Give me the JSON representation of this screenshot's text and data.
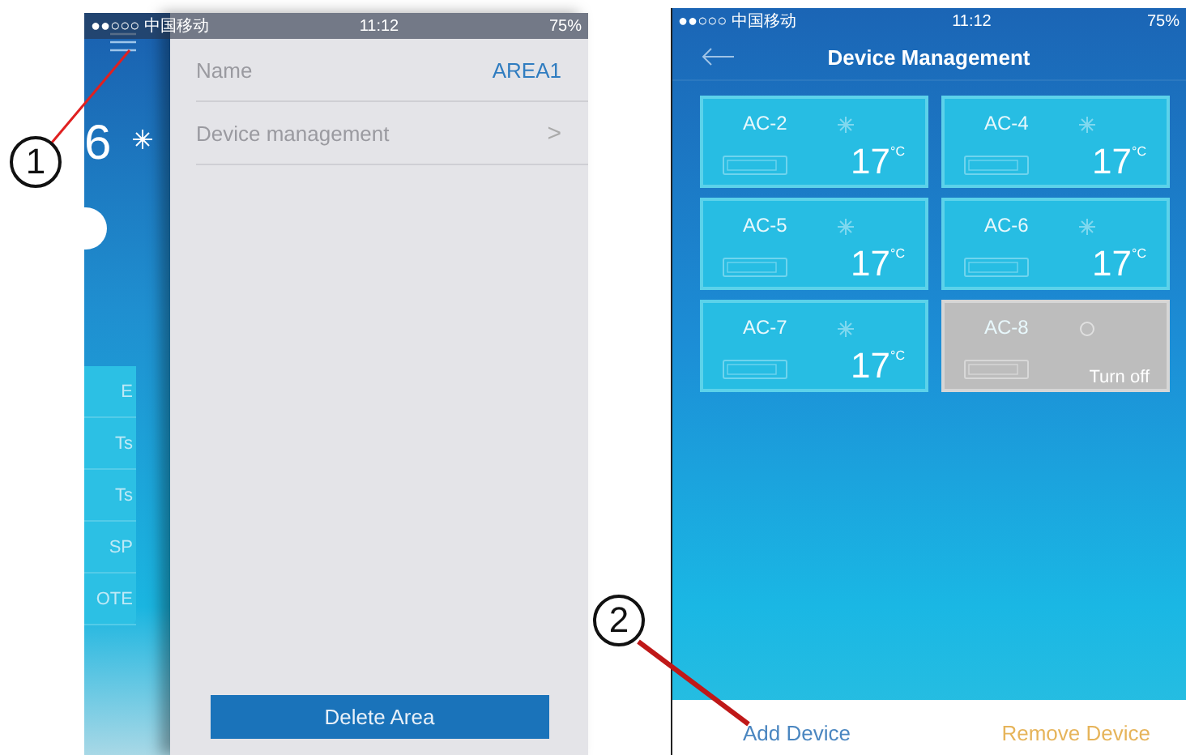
{
  "callouts": [
    {
      "number": "1"
    },
    {
      "number": "2"
    }
  ],
  "left_phone": {
    "status_bar": {
      "carrier": "●●○○○ 中国移动",
      "time": "11:12",
      "battery": "75%"
    },
    "behind": {
      "temperature": "6",
      "menu_items": [
        "E",
        "Ts",
        "Ts",
        "SP",
        "OTE"
      ]
    },
    "settings": [
      {
        "label": "Name",
        "value": "AREA1",
        "kind": "value"
      },
      {
        "label": "Device management",
        "value": ">",
        "kind": "link"
      }
    ],
    "delete_button": "Delete Area"
  },
  "right_phone": {
    "status_bar": {
      "carrier": "●●○○○ 中国移动",
      "time": "11:12",
      "battery": "75%"
    },
    "title": "Device Management",
    "devices": [
      {
        "name": "AC-2",
        "on": true,
        "temperature": "17",
        "unit": "°C"
      },
      {
        "name": "AC-4",
        "on": true,
        "temperature": "17",
        "unit": "°C"
      },
      {
        "name": "AC-5",
        "on": true,
        "temperature": "17",
        "unit": "°C"
      },
      {
        "name": "AC-6",
        "on": true,
        "temperature": "17",
        "unit": "°C"
      },
      {
        "name": "AC-7",
        "on": true,
        "temperature": "17",
        "unit": "°C"
      },
      {
        "name": "AC-8",
        "on": false,
        "status": "Turn off"
      }
    ],
    "add_button": "Add Device",
    "remove_button": "Remove Device"
  }
}
